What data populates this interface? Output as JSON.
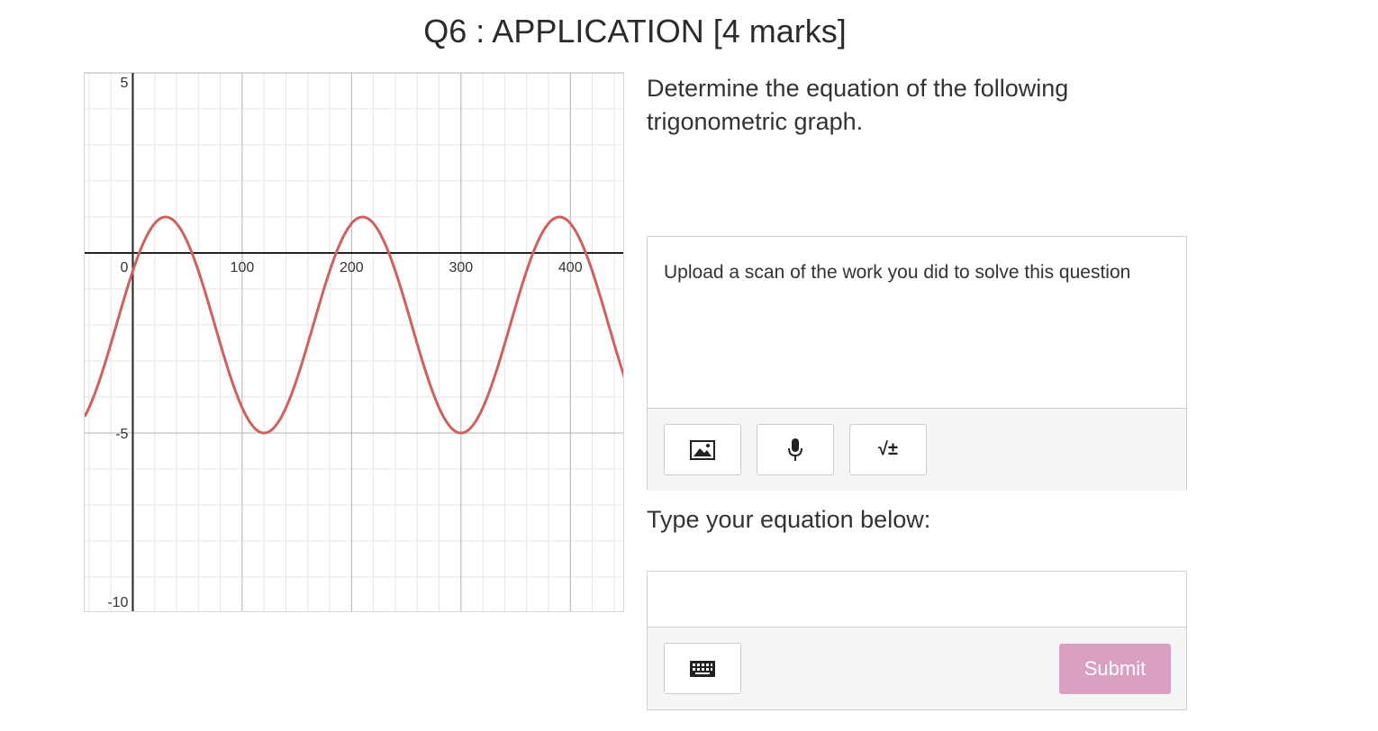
{
  "question": {
    "title": "Q6 : APPLICATION [4 marks]",
    "prompt": "Determine the equation of the following trigonometric graph."
  },
  "upload": {
    "instructions": "Upload a scan of the work you did to solve this question",
    "buttons": [
      {
        "icon": "image-icon"
      },
      {
        "icon": "microphone-icon"
      },
      {
        "icon": "math-symbols-icon",
        "glyph": "√±"
      }
    ]
  },
  "equation": {
    "label": "Type your equation below:",
    "value": "",
    "keyboard_icon": "keyboard-icon",
    "submit_label": "Submit"
  },
  "colors": {
    "curve": "#d0605e",
    "submit": "#d9a0c2",
    "axis": "#222222",
    "major_grid": "#b5b5b5",
    "minor_grid": "#e6e6e6"
  },
  "chart_data": {
    "type": "line",
    "title": "",
    "xlabel": "",
    "ylabel": "",
    "xlim": [
      -44,
      450
    ],
    "ylim": [
      -10,
      5
    ],
    "x_ticks": [
      "0",
      "100",
      "200",
      "300",
      "400"
    ],
    "y_ticks": [
      "5",
      "0",
      "-5",
      "-10"
    ],
    "grid": true,
    "series": [
      {
        "function": "sine",
        "amplitude": 3,
        "period": 180,
        "phase_shift": -15,
        "vertical_shift": -2,
        "maxima": [
          [
            30,
            1
          ],
          [
            210,
            1
          ],
          [
            390,
            1
          ]
        ],
        "minima": [
          [
            120,
            -5
          ],
          [
            300,
            -5
          ]
        ]
      }
    ]
  }
}
